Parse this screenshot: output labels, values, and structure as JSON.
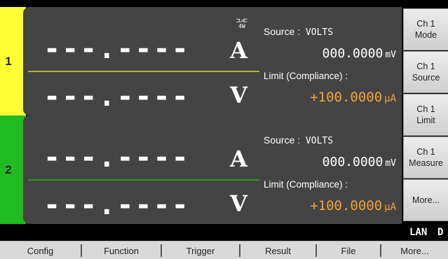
{
  "channels": [
    {
      "number": "1",
      "strip_color": "#ffff33",
      "divider_color": "#b8b227",
      "readout_current": "---.----",
      "current_unit": "A",
      "readout_voltage": "---.----",
      "voltage_unit": "V",
      "source_label": "Source :",
      "source_value": "VOLTS",
      "source_level": "000.0000",
      "source_unit": "mV",
      "limit_label": "Limit (Compliance) :",
      "limit_value": "+100.0000",
      "limit_unit": "µA",
      "wire_mode": "4W",
      "wire_symbol": "⊐⩘⊏"
    },
    {
      "number": "2",
      "strip_color": "#22bb22",
      "divider_color": "#1e9e1e",
      "readout_current": "---.----",
      "current_unit": "A",
      "readout_voltage": "---.----",
      "voltage_unit": "V",
      "source_label": "Source :",
      "source_value": "VOLTS",
      "source_level": "000.0000",
      "source_unit": "mV",
      "limit_label": "Limit (Compliance) :",
      "limit_value": "+100.0000",
      "limit_unit": "µA"
    }
  ],
  "softkeys": [
    {
      "line1": "Ch 1",
      "line2": "Mode"
    },
    {
      "line1": "Ch 1",
      "line2": "Source"
    },
    {
      "line1": "Ch 1",
      "line2": "Limit"
    },
    {
      "line1": "Ch 1",
      "line2": "Measure"
    },
    {
      "line1": "More...",
      "line2": ""
    }
  ],
  "status": {
    "lan": "LAN",
    "mode_indicator": "D"
  },
  "function_keys": [
    "Config",
    "Function",
    "Trigger",
    "Result",
    "File",
    "More..."
  ]
}
